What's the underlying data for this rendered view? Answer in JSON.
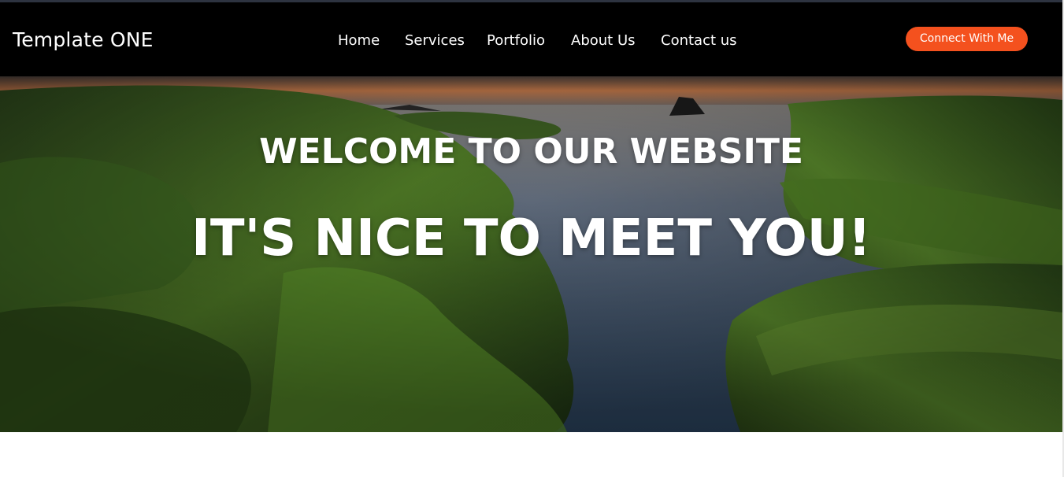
{
  "brand": {
    "title": "Template ONE"
  },
  "nav": {
    "items": [
      {
        "label": "Home"
      },
      {
        "label": "Services"
      },
      {
        "label": "Portfolio"
      },
      {
        "label": "About Us"
      },
      {
        "label": "Contact us"
      }
    ],
    "cta_label": "Connect With Me"
  },
  "hero": {
    "heading": "WELCOME TO OUR WEBSITE",
    "subheading": "IT'S NICE TO MEET YOU!",
    "image": "mossy-rocks-sunset-seascape"
  },
  "colors": {
    "navbar_bg": "#000000",
    "cta_bg": "#f4511e",
    "text": "#ffffff"
  }
}
